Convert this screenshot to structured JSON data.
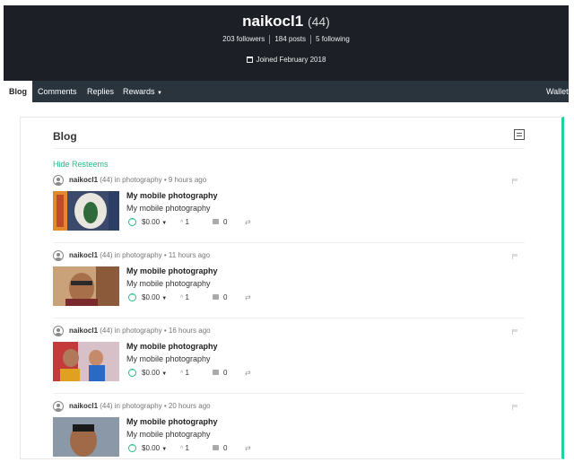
{
  "profile": {
    "name": "naikocl1",
    "reputation": "(44)",
    "followers": "203 followers",
    "posts": "184 posts",
    "following": "5 following",
    "joined": "Joined February 2018"
  },
  "nav": {
    "blog": "Blog",
    "comments": "Comments",
    "replies": "Replies",
    "rewards": "Rewards",
    "wallet": "Wallet"
  },
  "blog": {
    "title": "Blog",
    "hide_resteems": "Hide Resteems"
  },
  "colors": {
    "accent": "#20d39e",
    "header_bg": "#1c1f26",
    "nav_bg": "#2a343d"
  },
  "posts": [
    {
      "author": "naikocl1",
      "rep": "(44)",
      "category": "in photography",
      "time": "• 9 hours ago",
      "title": "My mobile photography",
      "body": "My mobile photography",
      "payout": "$0.00",
      "votes": "1",
      "comments": "0"
    },
    {
      "author": "naikocl1",
      "rep": "(44)",
      "category": "in photography",
      "time": "• 11 hours ago",
      "title": "My mobile photography",
      "body": "My mobile photography",
      "payout": "$0.00",
      "votes": "1",
      "comments": "0"
    },
    {
      "author": "naikocl1",
      "rep": "(44)",
      "category": "in photography",
      "time": "• 16 hours ago",
      "title": "My mobile photography",
      "body": "My mobile photography",
      "payout": "$0.00",
      "votes": "1",
      "comments": "0"
    },
    {
      "author": "naikocl1",
      "rep": "(44)",
      "category": "in photography",
      "time": "• 20 hours ago",
      "title": "My mobile photography",
      "body": "My mobile photography",
      "payout": "$0.00",
      "votes": "1",
      "comments": "0"
    }
  ]
}
